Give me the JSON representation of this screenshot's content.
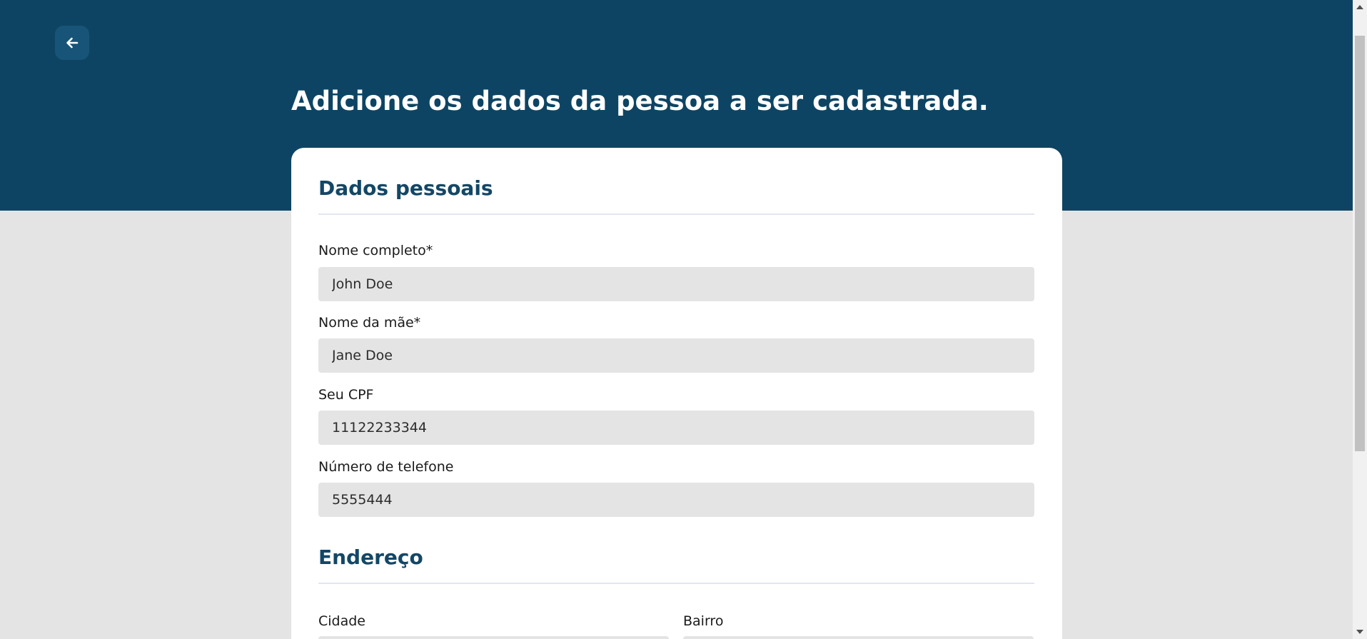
{
  "header": {
    "back_icon": "arrow-left-icon",
    "title": "Adicione os dados da pessoa a ser cadastrada."
  },
  "personal": {
    "section_title": "Dados pessoais",
    "full_name": {
      "label": "Nome completo*",
      "value": "John Doe"
    },
    "mother_name": {
      "label": "Nome da mãe*",
      "value": "Jane Doe"
    },
    "cpf": {
      "label": "Seu CPF",
      "value": "11122233344"
    },
    "phone": {
      "label": "Número de telefone",
      "value": "5555444"
    }
  },
  "address": {
    "section_title": "Endereço",
    "city": {
      "label": "Cidade",
      "value": ""
    },
    "neighborhood": {
      "label": "Bairro",
      "value": ""
    }
  },
  "colors": {
    "header_bg": "#0e4463",
    "section_title": "#134766",
    "input_bg": "#e4e4e4"
  }
}
